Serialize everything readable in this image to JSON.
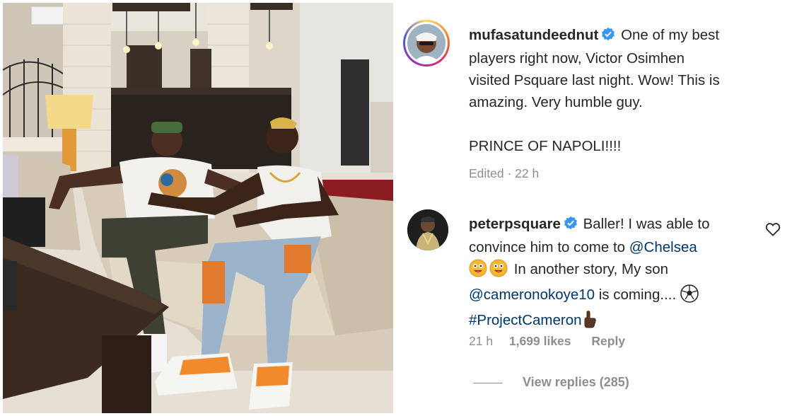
{
  "photo": {
    "description_icon": "photo-two-men-on-sofa"
  },
  "comment1": {
    "username": "mufasatundeednut",
    "verified_icon": "verified-badge-icon",
    "text_line1": "One of my best",
    "text_line2": "players right now, Victor Osimhen",
    "text_line3": "visited Psquare last night. Wow! This is",
    "text_line4": "amazing. Very humble guy.",
    "text_line5": "PRINCE OF NAPOLI!!!!",
    "time": "Edited · 22 h"
  },
  "comment2": {
    "username": "peterpsquare",
    "verified_icon": "verified-badge-icon",
    "text_line1": "Baller! I was able to",
    "text_line2_pre": "convince him to come to ",
    "mention1": "@Chelsea",
    "text_line3": "In another story, My son",
    "mention2": "@cameronokoye10",
    "text_line4_post": " is coming.... ",
    "hashtag": "#ProjectCameron",
    "time": "21 h",
    "likes": "1,699 likes",
    "reply": "Reply",
    "heart_icon": "heart-outline-icon"
  },
  "replies": {
    "label": "View replies (285)"
  },
  "colors": {
    "verified": "#3897f0",
    "link": "#00376b",
    "meta": "#8e8e8e",
    "text": "#262626"
  }
}
